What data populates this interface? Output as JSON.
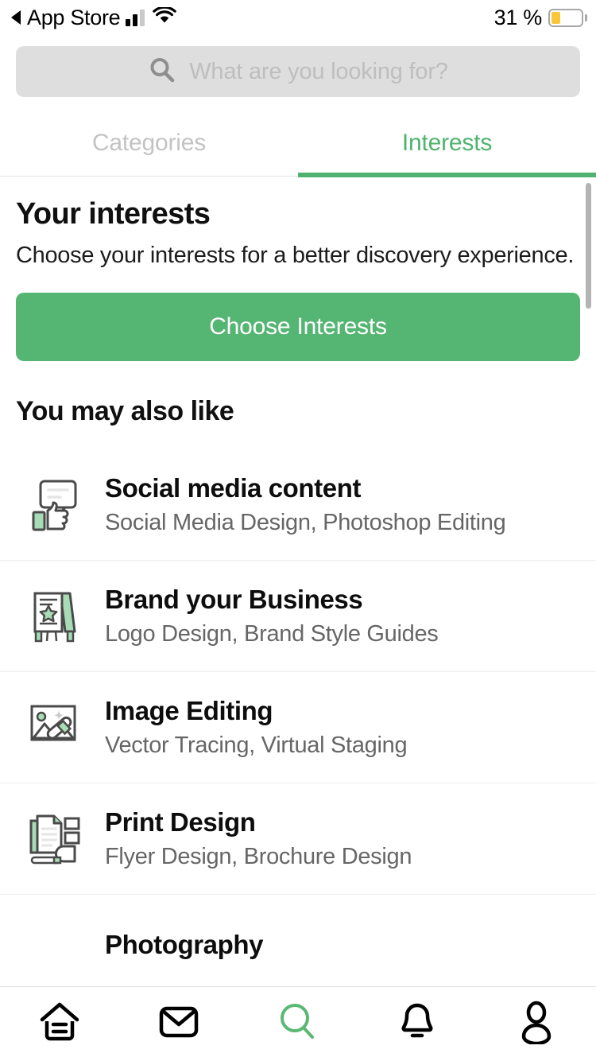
{
  "statusbar": {
    "back_arrow_icon": "triangle-left-icon",
    "carrier_label": "App Store",
    "signal_icon": "cellular-signal-icon",
    "wifi_icon": "wifi-icon",
    "battery_percent": "31 %",
    "battery_icon": "battery-low-icon",
    "battery_color": "#fac73c"
  },
  "search": {
    "icon": "search-icon",
    "placeholder": "What are you looking for?",
    "value": ""
  },
  "tabs": {
    "items": [
      {
        "label": "Categories",
        "active": false
      },
      {
        "label": "Interests",
        "active": true
      }
    ],
    "active_color": "#4fb36d",
    "inactive_color": "#c3c3c3"
  },
  "interests": {
    "heading": "Your interests",
    "subtitle": "Choose your interests for a better discovery experience.",
    "cta_label": "Choose Interests",
    "cta_color": "#55b572"
  },
  "suggestions": {
    "heading": "You may also like",
    "items": [
      {
        "icon": "speech-bubble-thumbs-up-icon",
        "title": "Social media content",
        "subtitle": "Social Media Design, Photoshop Editing"
      },
      {
        "icon": "easel-sign-star-icon",
        "title": "Brand your Business",
        "subtitle": "Logo Design, Brand Style Guides"
      },
      {
        "icon": "photo-magic-wand-icon",
        "title": "Image Editing",
        "subtitle": "Vector Tracing, Virtual Staging"
      },
      {
        "icon": "documents-print-icon",
        "title": "Print Design",
        "subtitle": "Flyer Design, Brochure Design"
      },
      {
        "icon": "camera-icon",
        "title": "Photography",
        "subtitle": ""
      }
    ]
  },
  "tabbar": {
    "items": [
      {
        "icon": "home-icon",
        "active": false
      },
      {
        "icon": "inbox-envelope-icon",
        "active": false
      },
      {
        "icon": "search-icon",
        "active": true
      },
      {
        "icon": "bell-notifications-icon",
        "active": false
      },
      {
        "icon": "profile-person-icon",
        "active": false
      }
    ],
    "active_color": "#5bb873"
  }
}
